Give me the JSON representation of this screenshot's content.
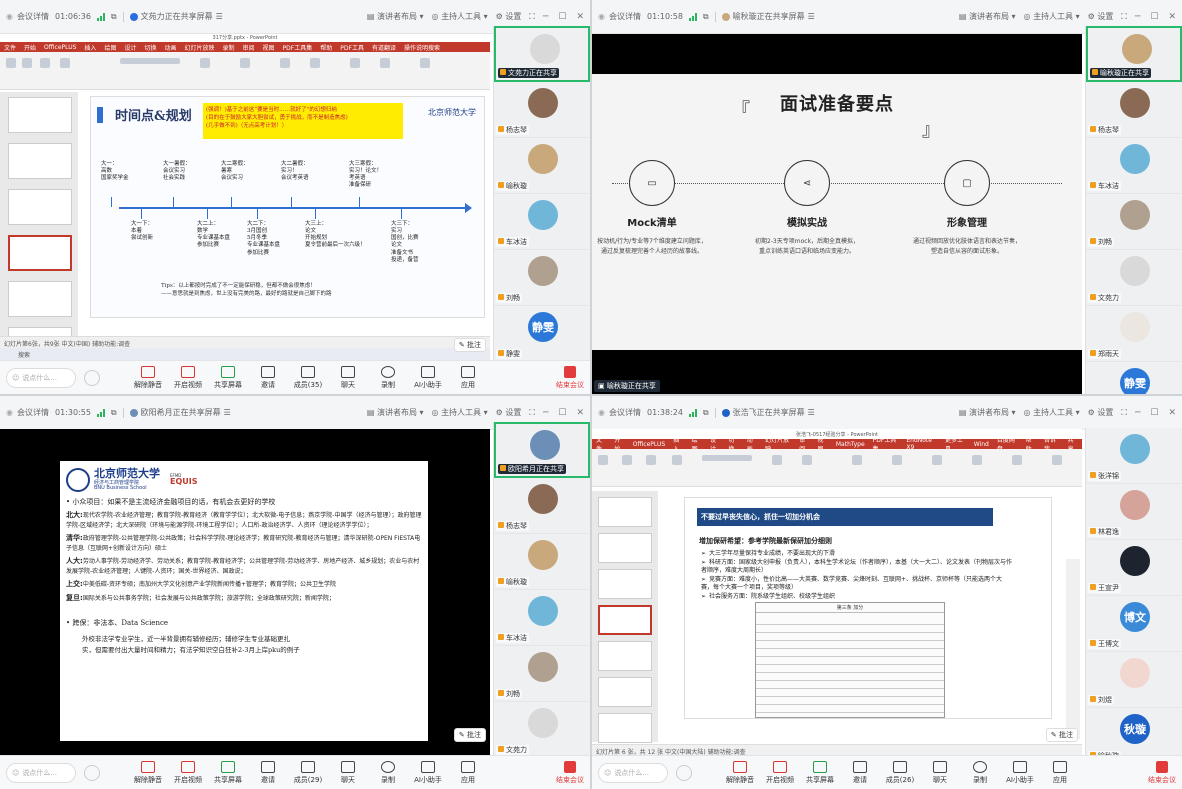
{
  "colors": {
    "accent": "#2b6ee0",
    "end": "#e23b3b",
    "share_green": "#29b96b",
    "ppt_red": "#c0392b"
  },
  "common": {
    "details": "会议详情",
    "presenter_layout": "演讲者布局",
    "host_tools": "主持人工具",
    "settings": "设置",
    "say_placeholder": "说点什么...",
    "controls": [
      "解除静音",
      "开启视频",
      "共享屏幕",
      "邀请",
      "聊天",
      "录制",
      "AI小助手",
      "应用"
    ],
    "end": "结束会议",
    "annotate": "批注"
  },
  "q1": {
    "time": "01:06:36",
    "share_text": "文苑力正在共享屏幕",
    "members": "成员(35)",
    "file_title": "317分享.pptx - PowerPoint",
    "ppt_menu": [
      "文件",
      "开始",
      "OfficePLUS",
      "插入",
      "绘图",
      "设计",
      "切换",
      "动画",
      "幻灯片放映",
      "录制",
      "审阅",
      "视图",
      "PDF工具集",
      "帮助",
      "PDF工具",
      "有道翻译",
      "操作说明搜索"
    ],
    "slide_title": "时间点&规划",
    "slide_note": "(强调！)基于之前这“要是当时……就好了”的幻想归纳\n(目的在于鼓励大家大胆尝试，勇于挑战，而不是制造焦虑)\n(几乎做不到)（无点高考计划！）",
    "logo": "北京师范大学",
    "timeline_top": [
      "大一：\n高数\n国家奖学金",
      "大一暑假：\n会议实习\n社会实践",
      "大二寒假：\n暑寒\n会议实习",
      "大二暑假：\n实习！\n会议考英语",
      "大三寒假：\n实习！论文！\n考英语\n准备保研"
    ],
    "timeline_bottom": [
      "大一下：\n本着\n尝试创新",
      "大二上：\n数学\n专业课基本盘\n参加比赛",
      "大二下：\n3月国创\n5月冬季\n专业课基本盘\n参加比赛",
      "大三上：\n论文\n开始规划\n夏令营前最后一次六级！",
      "大三下：\n实习\n国创，比赛\n论文\n准备文书\n投递，备营"
    ],
    "tips": "Tips：以上都按时完成了不一定能保研稳，但都不做会很焦虑！\n——意思就是到焦虑，世上没有完美的路，最好的路就是自己脚下的路",
    "thumb_count": 6,
    "status": "幻灯片第6张，共9张  中文(中国)  辅助功能:调查",
    "taskbar": "搜索",
    "tiles": [
      {
        "name": "文苑力正在共享",
        "color": "#d9d9d9",
        "sharing": true
      },
      {
        "name": "杨志琴",
        "color": "#8a6a55"
      },
      {
        "name": "喻秋璇",
        "color": "#c9a87c"
      },
      {
        "name": "车冰洁",
        "color": "#6fb6d8"
      },
      {
        "name": "刘畅",
        "color": "#b0a090"
      },
      {
        "name": "静雯",
        "color": "#2b78d8",
        "text": "静雯"
      }
    ]
  },
  "q2": {
    "time": "01:10:58",
    "share_text": "喻秋璇正在共享屏幕",
    "members": "成员(35)",
    "slide_title": "面试准备要点",
    "bracket_l": "『",
    "bracket_r": "』",
    "cols": [
      {
        "icon": "UI",
        "title": "Mock清单",
        "desc": "按动机/行为/专业等7个维度建立问题库，\n通过反复梳理完善个人经历的故事线。"
      },
      {
        "icon": "share",
        "title": "模拟实战",
        "desc": "初期2-3天专项mock，后期全真模拟，\n重点训练英语口语和临场应变能力。"
      },
      {
        "icon": "chat",
        "title": "形象管理",
        "desc": "通过视频回放优化肢体语言和表达节奏，\n塑造自信从容的面试形象。"
      }
    ],
    "bottom_share": "喻秋璇正在共享",
    "tiles": [
      {
        "name": "喻秋璇正在共享",
        "color": "#c9a87c",
        "sharing": true
      },
      {
        "name": "杨志琴",
        "color": "#8a6a55"
      },
      {
        "name": "车冰洁",
        "color": "#6fb6d8"
      },
      {
        "name": "刘畅",
        "color": "#b0a090"
      },
      {
        "name": "文苑力",
        "color": "#d9d9d9"
      },
      {
        "name": "郑雨天",
        "color": "#ece6e0"
      },
      {
        "name": "静雯",
        "color": "#2b78d8",
        "text": "静雯"
      }
    ]
  },
  "q3": {
    "time": "01:30:55",
    "share_text": "欧阳希月正在共享屏幕",
    "members": "成员(29)",
    "logo_cn": "北京师范大学",
    "logo_sub": "经济与工商管理学院",
    "logo_en": "BNU Business School",
    "equis": "EQUIS",
    "efmd": "EFMD",
    "bullet1": "小众项目：如果不是主流经济金融项目的话，有机会去更好的学校",
    "schools": [
      {
        "k": "北大:",
        "v": "现代农学院-农业经济管理；教育学院-教育经济（教育学学位）；北大软微-电子信息；燕京学院-中国学（经济与管理）；政府管理学院-区域经济学；北大深研院（环境与能源学院-环境工程学位）；人口所-政治经济学、人资环（理论经济学学位）；"
      },
      {
        "k": "清华:",
        "v": "政府管理学院-公共管理学院-公共政策；社会科学学院-理论经济学；教育研究院-教育经济与管理；清华深研院-OPEN FIESTA电子信息（互联网+创新设计方向）硕士"
      },
      {
        "k": "人大:",
        "v": "劳动人事学院-劳动经济学、劳动关系；教育学院-教育经济学；公共管理学院-劳动经济学、房地产经济、城乡规划；农业与农村发展学院-农业经济管理；人键院-人资环；国关-世界经济、国政说；"
      },
      {
        "k": "上交:",
        "v": "中美低碳-资环专硕；南加州大学文化创意产业学院新闻传播+管理学；教育学院；公共卫生学院"
      },
      {
        "k": "复旦:",
        "v": "国际关系与公共事务学院；社会发展与公共政策学院；旅游学院；全球政策研究院；新闻学院；"
      }
    ],
    "bullet2": "跨保：非法本、Data Science",
    "para": "外校非法学专业学生，近一半背景拥有辅修经历；辅修学生专业基础更扎\n实，但需要付出大量时间和精力；有法学知识空白狂补2-3月上岸pku的例子",
    "tiles": [
      {
        "name": "欧阳希月正在共享",
        "color": "#6c8fb8",
        "sharing": true
      },
      {
        "name": "杨志琴",
        "color": "#8a6a55"
      },
      {
        "name": "喻秋璇",
        "color": "#c9a87c"
      },
      {
        "name": "车冰洁",
        "color": "#6fb6d8"
      },
      {
        "name": "刘畅",
        "color": "#b0a090"
      },
      {
        "name": "文苑力",
        "color": "#d9d9d9"
      }
    ]
  },
  "q4": {
    "time": "01:38:24",
    "share_text": "张浩飞正在共享屏幕",
    "members": "成员(26)",
    "file_title": "张浩飞-0517经验分享 - PowerPoint",
    "ppt_menu": [
      "文件",
      "开始",
      "OfficePLUS",
      "插入",
      "绘图",
      "设计",
      "切换",
      "动画",
      "幻灯片放映",
      "审阅",
      "视图",
      "MathType",
      "PDF工具集",
      "EndNote X9",
      "更多工具",
      "Wind",
      "百度网盘",
      "帮助",
      "告诉我",
      "共享"
    ],
    "slide_header": "不要过早丧失信心，抓住一切加分机会",
    "slide_sub": "增加保研希望：参考学院最新保研加分细则",
    "items": [
      "大三学年尽量保持专业成绩，不要出现大的下滑",
      "科研方面：国家级大创申报（负责人），本科生学术论坛（作者顺序），本基（大一大二）、论文发表（刊物层次与作者顺序，难度大周期长）",
      "竞赛方面：难度小，性价比高——大英赛、数学竞赛、尖烽时刻、互联网+、挑战杯、京师杯等（只能选两个大赛，每个大赛一个项目，奖项等级）",
      "社会服务方面：院系级学生组织、校级学生组织"
    ],
    "table_title": "第三条 加分",
    "status": "幻灯片第 6 张，共 12 张  中文(中国大陆)  辅助功能:调查",
    "thumb_count": 7,
    "tiles": [
      {
        "name": "张洋锦",
        "color": "#6fb6d8"
      },
      {
        "name": "林君逸",
        "color": "#d6a39a"
      },
      {
        "name": "王宣尹",
        "color": "#1d2430"
      },
      {
        "name": "王博文",
        "color": "#3a8ad8",
        "text": "博文"
      },
      {
        "name": "刘煜",
        "color": "#f2d7d0"
      },
      {
        "name": "喻秋璇",
        "color": "#1f62c8",
        "text": "秋璇"
      }
    ]
  }
}
